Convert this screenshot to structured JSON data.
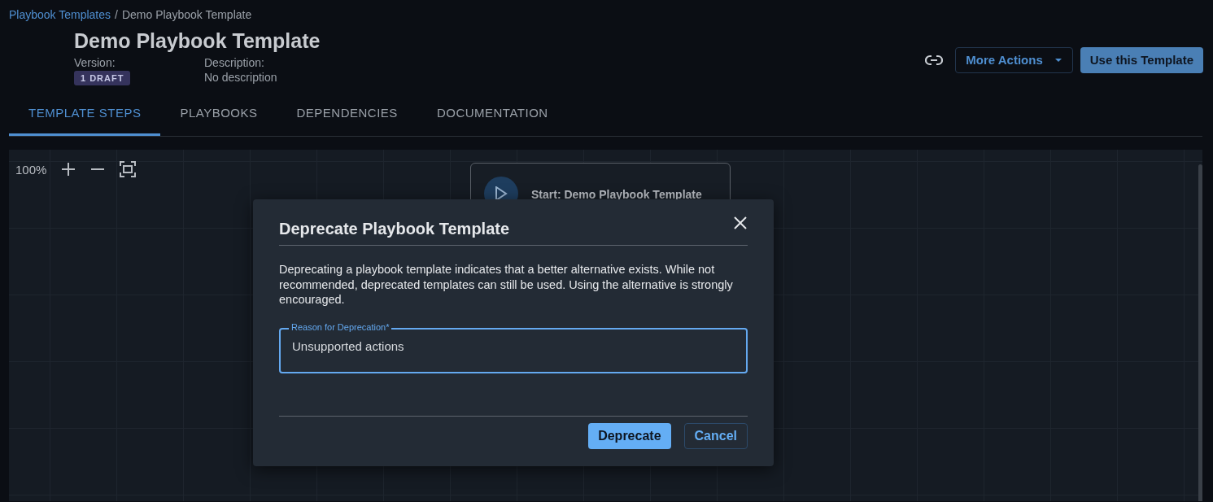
{
  "breadcrumb": {
    "separator": "/",
    "items": [
      {
        "label": "Playbook Templates",
        "kind": "link"
      },
      {
        "label": "Demo Playbook Template",
        "kind": "current"
      }
    ]
  },
  "title": "Demo Playbook Template",
  "version": {
    "label": "Version:",
    "badge": "1 DRAFT"
  },
  "description": {
    "label": "Description:",
    "value": "No description"
  },
  "actions": [
    {
      "kind": "icon"
    },
    {
      "label": "More Actions",
      "kind": "dropdown"
    },
    {
      "label": "Use this Template",
      "kind": "primary"
    }
  ],
  "tabs": [
    {
      "label": "TEMPLATE STEPS",
      "selected": true
    },
    {
      "label": "PLAYBOOKS",
      "selected": false
    },
    {
      "label": "DEPENDENCIES",
      "selected": false
    },
    {
      "label": "DOCUMENTATION",
      "selected": false
    }
  ],
  "canvas": {
    "zoom": "100%",
    "start_node": "Start: Demo Playbook Template"
  },
  "modal": {
    "title": "Deprecate Playbook Template",
    "body": "Deprecating a playbook template indicates that a better alternative exists. While not recommended, deprecated templates can still be used. Using the alternative is strongly encouraged.",
    "field": {
      "label": "Reason for Deprecation*",
      "value": "Unsupported actions"
    },
    "buttons": [
      {
        "label": "Deprecate",
        "kind": "primary"
      },
      {
        "label": "Cancel",
        "kind": "secondary"
      }
    ]
  }
}
